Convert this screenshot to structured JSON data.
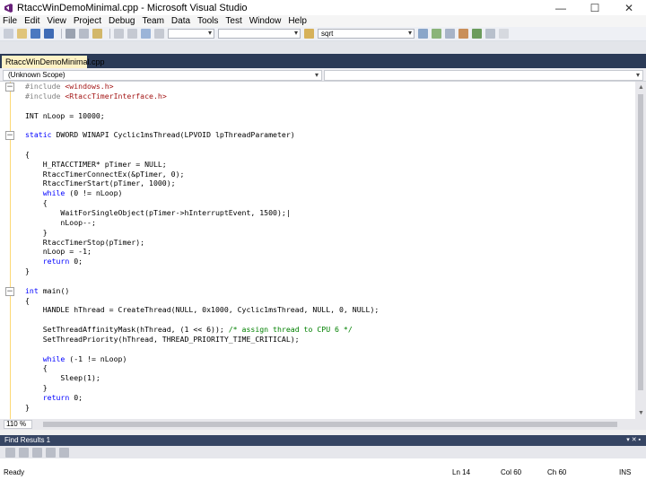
{
  "window": {
    "title": "RtaccWinDemoMinimal.cpp - Microsoft Visual Studio",
    "minimize": "—",
    "maximize": "☐",
    "close": "✕"
  },
  "menu": [
    {
      "label": "File",
      "name": "menu-file"
    },
    {
      "label": "Edit",
      "name": "menu-edit"
    },
    {
      "label": "View",
      "name": "menu-view"
    },
    {
      "label": "Project",
      "name": "menu-project"
    },
    {
      "label": "Debug",
      "name": "menu-debug"
    },
    {
      "label": "Team",
      "name": "menu-team"
    },
    {
      "label": "Data",
      "name": "menu-data"
    },
    {
      "label": "Tools",
      "name": "menu-tools"
    },
    {
      "label": "Test",
      "name": "menu-test"
    },
    {
      "label": "Window",
      "name": "menu-window"
    },
    {
      "label": "Help",
      "name": "menu-help"
    }
  ],
  "toolbar": {
    "find_value": "sqrt"
  },
  "tab": {
    "label": "RtaccWinDemoMinimal.cpp"
  },
  "scope": {
    "left": "(Unknown Scope)",
    "right": ""
  },
  "code_lines": [
    [
      {
        "t": "#include ",
        "c": "pp"
      },
      {
        "t": "<windows.h>",
        "c": "str"
      }
    ],
    [
      {
        "t": "#include ",
        "c": "pp"
      },
      {
        "t": "<RtaccTimerInterface.h>",
        "c": "str"
      }
    ],
    [],
    [
      {
        "t": "INT nLoop = 10000;",
        "c": ""
      }
    ],
    [],
    [
      {
        "t": "static",
        "c": "kw"
      },
      {
        "t": " DWORD WINAPI Cyclic1msThread(LPVOID lpThreadParameter)",
        "c": ""
      }
    ],
    [],
    [
      {
        "t": "{",
        "c": ""
      }
    ],
    [
      {
        "t": "    H_RTACCTIMER* pTimer = NULL;",
        "c": ""
      }
    ],
    [
      {
        "t": "    RtaccTimerConnectEx(&pTimer, 0);",
        "c": ""
      }
    ],
    [
      {
        "t": "    RtaccTimerStart(pTimer, 1000);",
        "c": ""
      }
    ],
    [
      {
        "t": "    ",
        "c": ""
      },
      {
        "t": "while",
        "c": "kw"
      },
      {
        "t": " (0 != nLoop)",
        "c": ""
      }
    ],
    [
      {
        "t": "    {",
        "c": ""
      }
    ],
    [
      {
        "t": "        WaitForSingleObject(pTimer->hInterruptEvent, 1500);|",
        "c": ""
      }
    ],
    [
      {
        "t": "        nLoop--;",
        "c": ""
      }
    ],
    [
      {
        "t": "    }",
        "c": ""
      }
    ],
    [
      {
        "t": "    RtaccTimerStop(pTimer);",
        "c": ""
      }
    ],
    [
      {
        "t": "    nLoop = -1;",
        "c": ""
      }
    ],
    [
      {
        "t": "    ",
        "c": ""
      },
      {
        "t": "return",
        "c": "kw"
      },
      {
        "t": " 0;",
        "c": ""
      }
    ],
    [
      {
        "t": "}",
        "c": ""
      }
    ],
    [],
    [
      {
        "t": "int",
        "c": "kw"
      },
      {
        "t": " main()",
        "c": ""
      }
    ],
    [
      {
        "t": "{",
        "c": ""
      }
    ],
    [
      {
        "t": "    HANDLE hThread = CreateThread(NULL, 0x1000, Cyclic1msThread, NULL, 0, NULL);",
        "c": ""
      }
    ],
    [],
    [
      {
        "t": "    SetThreadAffinityMask(hThread, (1 << 6)); ",
        "c": ""
      },
      {
        "t": "/* assign thread to CPU 6 */",
        "c": "com"
      }
    ],
    [
      {
        "t": "    SetThreadPriority(hThread, THREAD_PRIORITY_TIME_CRITICAL);",
        "c": ""
      }
    ],
    [],
    [
      {
        "t": "    ",
        "c": ""
      },
      {
        "t": "while",
        "c": "kw"
      },
      {
        "t": " (-1 != nLoop)",
        "c": ""
      }
    ],
    [
      {
        "t": "    {",
        "c": ""
      }
    ],
    [
      {
        "t": "        Sleep(1);",
        "c": ""
      }
    ],
    [
      {
        "t": "    }",
        "c": ""
      }
    ],
    [
      {
        "t": "    ",
        "c": ""
      },
      {
        "t": "return",
        "c": "kw"
      },
      {
        "t": " 0;",
        "c": ""
      }
    ],
    [
      {
        "t": "}",
        "c": ""
      }
    ]
  ],
  "editor": {
    "zoom": "110 %"
  },
  "find_results": {
    "title": "Find Results 1",
    "controls": "▾ ✕ ▪"
  },
  "status": {
    "ready": "Ready",
    "line": "Ln 14",
    "col": "Col 60",
    "ch": "Ch 60",
    "mode": "INS"
  },
  "colors": {
    "accent": "#2b3a57",
    "tab_active": "#fef2c6",
    "keyword": "#0000ff",
    "string": "#a31515",
    "comment": "#008000"
  }
}
